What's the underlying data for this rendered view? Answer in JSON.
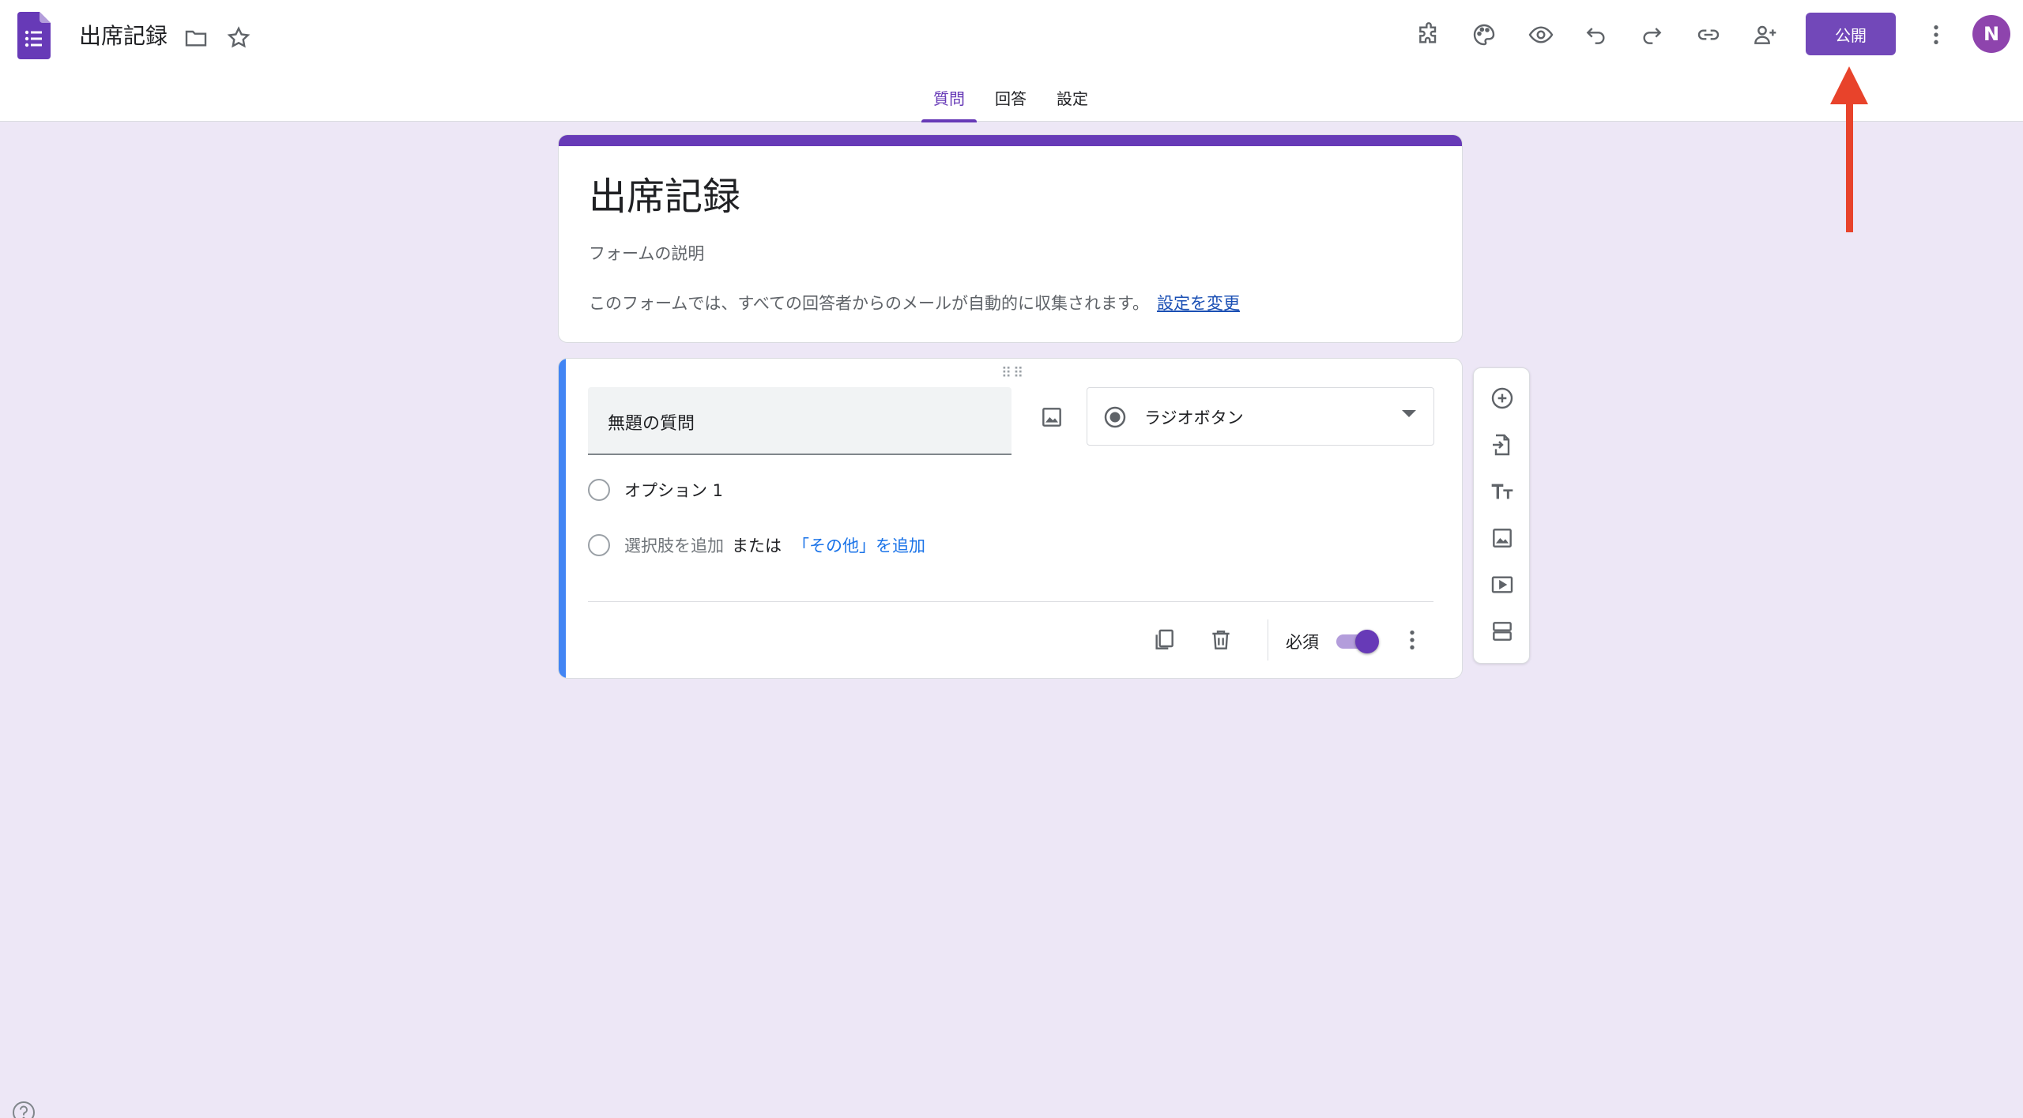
{
  "header": {
    "doc_title": "出席記録",
    "publish_label": "公開",
    "avatar_initial": "N",
    "accent_color": "#673ab7",
    "publish_color": "#7248b9"
  },
  "tabs": [
    {
      "label": "質問",
      "active": true
    },
    {
      "label": "回答",
      "active": false
    },
    {
      "label": "設定",
      "active": false
    }
  ],
  "form": {
    "title": "出席記録",
    "description_placeholder": "フォームの説明",
    "email_note": "このフォームでは、すべての回答者からのメールが自動的に収集されます。",
    "change_settings_link": "設定を変更"
  },
  "question": {
    "title": "無題の質問",
    "type": "ラジオボタン",
    "options": [
      "オプション 1"
    ],
    "add_option": "選択肢を追加",
    "or_text": "または",
    "add_other": "「その他」を追加",
    "required_label": "必須",
    "required": true
  },
  "icons": {
    "header": [
      "folder-icon",
      "star-icon",
      "addon-icon",
      "palette-icon",
      "preview-icon",
      "undo-icon",
      "redo-icon",
      "link-icon",
      "add-collaborator-icon",
      "more-vert-icon"
    ],
    "side_toolbar": [
      "add-question-icon",
      "import-questions-icon",
      "add-title-icon",
      "add-image-icon",
      "add-video-icon",
      "add-section-icon"
    ]
  }
}
